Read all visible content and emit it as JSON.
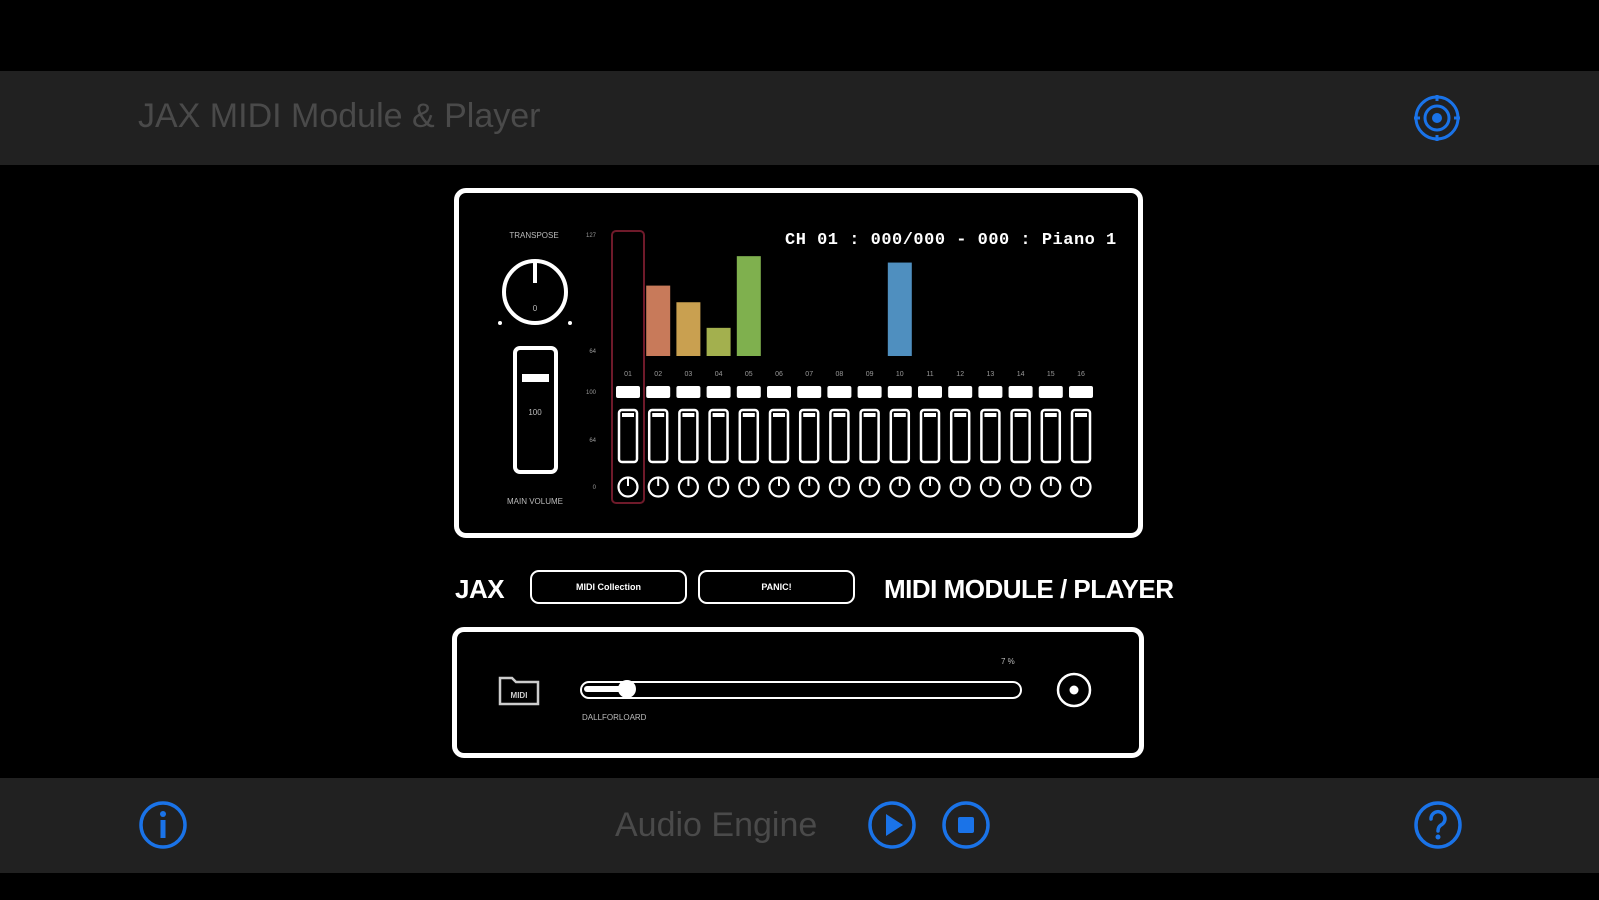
{
  "header": {
    "title": "JAX MIDI Module & Player",
    "settings_icon": "gear-icon"
  },
  "mixer": {
    "transpose_label": "TRANSPOSE",
    "transpose_value": "0",
    "volume_value": "100",
    "master_volume_label": "MAIN VOLUME",
    "meter_scale": [
      "127",
      "64",
      "100",
      "64",
      "0"
    ],
    "channel_info": "CH 01 : 000/000 - 000 : Piano 1",
    "selected_channel": 1,
    "channels": [
      {
        "num": "01",
        "level": 0,
        "color": "#c87a5a"
      },
      {
        "num": "02",
        "level": 0.55,
        "color": "#c87a5a"
      },
      {
        "num": "03",
        "level": 0.42,
        "color": "#c9a050"
      },
      {
        "num": "04",
        "level": 0.22,
        "color": "#a3b04e"
      },
      {
        "num": "05",
        "level": 0.78,
        "color": "#7fb04e"
      },
      {
        "num": "06",
        "level": 0,
        "color": "#7fb04e"
      },
      {
        "num": "07",
        "level": 0,
        "color": "#7fb04e"
      },
      {
        "num": "08",
        "level": 0,
        "color": "#7fb04e"
      },
      {
        "num": "09",
        "level": 0,
        "color": "#4f8fbf"
      },
      {
        "num": "10",
        "level": 0.73,
        "color": "#4f8fbf"
      },
      {
        "num": "11",
        "level": 0,
        "color": "#4f8fbf"
      },
      {
        "num": "12",
        "level": 0,
        "color": "#4f8fbf"
      },
      {
        "num": "13",
        "level": 0,
        "color": "#4f8fbf"
      },
      {
        "num": "14",
        "level": 0,
        "color": "#4f8fbf"
      },
      {
        "num": "15",
        "level": 0,
        "color": "#4f8fbf"
      },
      {
        "num": "16",
        "level": 0,
        "color": "#4f8fbf"
      }
    ]
  },
  "brand": {
    "left": "JAX",
    "right": "MIDI MODULE / PLAYER",
    "buttons": [
      "MIDI Collection",
      "PANIC!"
    ]
  },
  "player": {
    "folder_label": "MIDI",
    "file_name": "DALLFORLOARD",
    "progress_percent": 7,
    "progress_label": "7 %",
    "position_fraction": 0.07
  },
  "footer": {
    "engine_label": "Audio Engine",
    "info_icon": "info-icon",
    "play_icon": "play-icon",
    "stop_icon": "stop-icon",
    "help_icon": "help-icon"
  },
  "colors": {
    "accent": "#1a73e8",
    "panel_bar": "#212121",
    "selected_outline": "#6e1a2a"
  }
}
